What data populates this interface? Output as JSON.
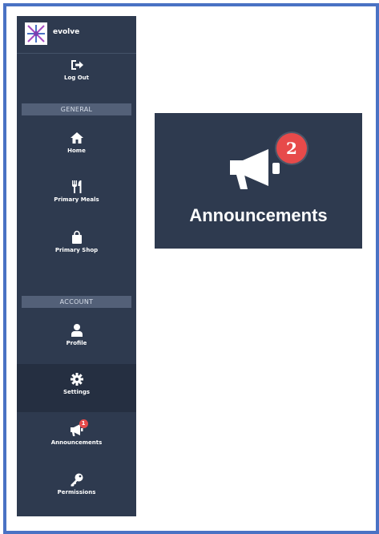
{
  "brand": {
    "name": "evolve"
  },
  "sidebar": {
    "logout_label": "Log Out",
    "sections": {
      "general": "GENERAL",
      "account": "ACCOUNT"
    },
    "items": [
      {
        "label": "Home"
      },
      {
        "label": "Primary Meals"
      },
      {
        "label": "Primary Shop"
      },
      {
        "label": "Profile"
      },
      {
        "label": "Settings"
      },
      {
        "label": "Announcements",
        "badge": "1"
      },
      {
        "label": "Permissions"
      }
    ]
  },
  "card": {
    "title": "Announcements",
    "badge": "2"
  },
  "colors": {
    "sidebar_bg": "#2e3a4f",
    "active_bg": "#252f41",
    "section_bg": "#536078",
    "badge": "#e74a4a",
    "frame_border": "#4a72c4"
  },
  "icons": [
    "logout-icon",
    "home-icon",
    "utensils-icon",
    "shopping-bag-icon",
    "user-icon",
    "gear-icon",
    "megaphone-icon",
    "key-icon"
  ]
}
